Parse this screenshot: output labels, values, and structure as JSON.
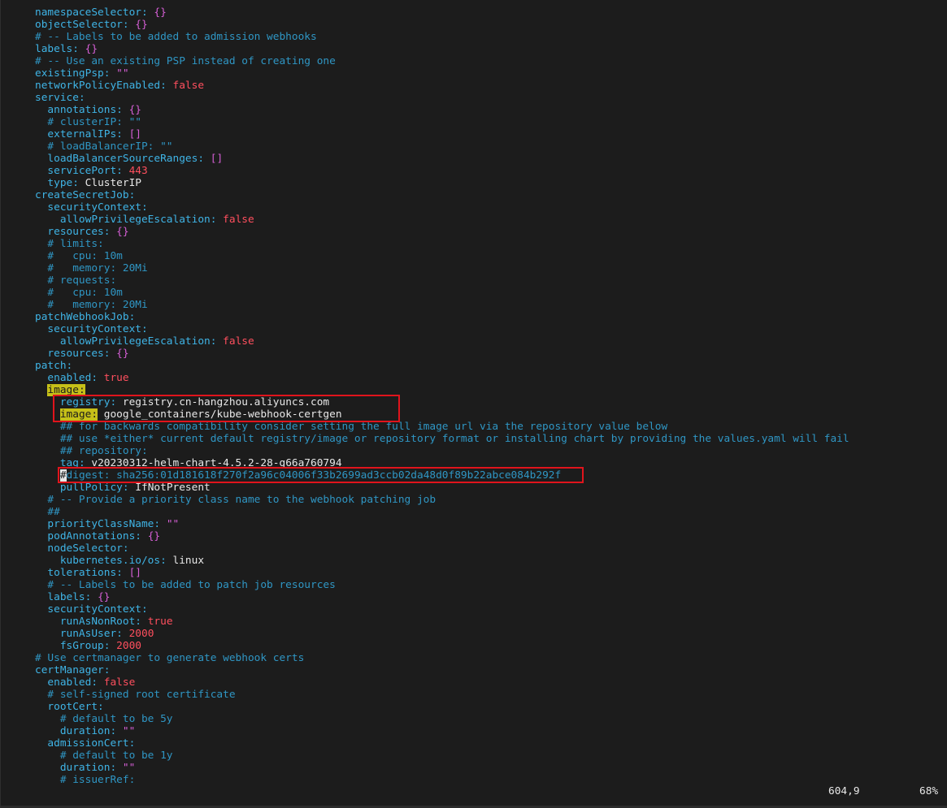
{
  "editor": {
    "lines": [
      [
        {
          "t": "namespaceSelector",
          "s": "k"
        },
        {
          "t": ": ",
          "s": "p"
        },
        {
          "t": "{}",
          "s": "b"
        }
      ],
      [
        {
          "t": "objectSelector",
          "s": "k"
        },
        {
          "t": ": ",
          "s": "p"
        },
        {
          "t": "{}",
          "s": "b"
        }
      ],
      [
        {
          "t": "# -- Labels to be added to admission webhooks",
          "s": "c"
        }
      ],
      [
        {
          "t": "labels",
          "s": "k"
        },
        {
          "t": ": ",
          "s": "p"
        },
        {
          "t": "{}",
          "s": "b"
        }
      ],
      [
        {
          "t": "# -- Use an existing PSP instead of creating one",
          "s": "c"
        }
      ],
      [
        {
          "t": "existingPsp",
          "s": "k"
        },
        {
          "t": ": ",
          "s": "p"
        },
        {
          "t": "\"\"",
          "s": "b"
        }
      ],
      [
        {
          "t": "networkPolicyEnabled",
          "s": "k"
        },
        {
          "t": ": ",
          "s": "p"
        },
        {
          "t": "false",
          "s": "n"
        }
      ],
      [
        {
          "t": "service",
          "s": "k"
        },
        {
          "t": ":",
          "s": "p"
        }
      ],
      [
        {
          "t": "  annotations",
          "s": "k"
        },
        {
          "t": ": ",
          "s": "p"
        },
        {
          "t": "{}",
          "s": "b"
        }
      ],
      [
        {
          "t": "  # clusterIP: \"\"",
          "s": "c"
        }
      ],
      [
        {
          "t": "  externalIPs",
          "s": "k"
        },
        {
          "t": ": ",
          "s": "p"
        },
        {
          "t": "[]",
          "s": "b"
        }
      ],
      [
        {
          "t": "  # loadBalancerIP: \"\"",
          "s": "c"
        }
      ],
      [
        {
          "t": "  loadBalancerSourceRanges",
          "s": "k"
        },
        {
          "t": ": ",
          "s": "p"
        },
        {
          "t": "[]",
          "s": "b"
        }
      ],
      [
        {
          "t": "  servicePort",
          "s": "k"
        },
        {
          "t": ": ",
          "s": "p"
        },
        {
          "t": "443",
          "s": "n"
        }
      ],
      [
        {
          "t": "  type",
          "s": "k"
        },
        {
          "t": ": ",
          "s": "p"
        },
        {
          "t": "ClusterIP",
          "s": "v"
        }
      ],
      [
        {
          "t": "createSecretJob",
          "s": "k"
        },
        {
          "t": ":",
          "s": "p"
        }
      ],
      [
        {
          "t": "  securityContext",
          "s": "k"
        },
        {
          "t": ":",
          "s": "p"
        }
      ],
      [
        {
          "t": "    allowPrivilegeEscalation",
          "s": "k"
        },
        {
          "t": ": ",
          "s": "p"
        },
        {
          "t": "false",
          "s": "n"
        }
      ],
      [
        {
          "t": "  resources",
          "s": "k"
        },
        {
          "t": ": ",
          "s": "p"
        },
        {
          "t": "{}",
          "s": "b"
        }
      ],
      [
        {
          "t": "  # limits:",
          "s": "c"
        }
      ],
      [
        {
          "t": "  #   cpu: 10m",
          "s": "c"
        }
      ],
      [
        {
          "t": "  #   memory: 20Mi",
          "s": "c"
        }
      ],
      [
        {
          "t": "  # requests:",
          "s": "c"
        }
      ],
      [
        {
          "t": "  #   cpu: 10m",
          "s": "c"
        }
      ],
      [
        {
          "t": "  #   memory: 20Mi",
          "s": "c"
        }
      ],
      [
        {
          "t": "patchWebhookJob",
          "s": "k"
        },
        {
          "t": ":",
          "s": "p"
        }
      ],
      [
        {
          "t": "  securityContext",
          "s": "k"
        },
        {
          "t": ":",
          "s": "p"
        }
      ],
      [
        {
          "t": "    allowPrivilegeEscalation",
          "s": "k"
        },
        {
          "t": ": ",
          "s": "p"
        },
        {
          "t": "false",
          "s": "n"
        }
      ],
      [
        {
          "t": "  resources",
          "s": "k"
        },
        {
          "t": ": ",
          "s": "p"
        },
        {
          "t": "{}",
          "s": "b"
        }
      ],
      [
        {
          "t": "patch",
          "s": "k"
        },
        {
          "t": ":",
          "s": "p"
        }
      ],
      [
        {
          "t": "  enabled",
          "s": "k"
        },
        {
          "t": ": ",
          "s": "p"
        },
        {
          "t": "true",
          "s": "n"
        }
      ],
      [
        {
          "t": "  ",
          "s": "v"
        },
        {
          "t": "image:",
          "s": "hl"
        }
      ],
      [
        {
          "t": "    registry",
          "s": "k"
        },
        {
          "t": ": ",
          "s": "p"
        },
        {
          "t": "registry.cn-hangzhou.aliyuncs.com",
          "s": "v"
        }
      ],
      [
        {
          "t": "    ",
          "s": "v"
        },
        {
          "t": "image:",
          "s": "hl"
        },
        {
          "t": " google_containers/kube-webhook-certgen",
          "s": "v"
        }
      ],
      [
        {
          "t": "    ## for backwards compatibility consider setting the full image url via the repository value below",
          "s": "c"
        }
      ],
      [
        {
          "t": "    ## use *either* current default registry/image or repository format or installing chart by providing the values.yaml will fail",
          "s": "c"
        }
      ],
      [
        {
          "t": "    ## repository:",
          "s": "c"
        }
      ],
      [
        {
          "t": "    tag",
          "s": "k"
        },
        {
          "t": ": ",
          "s": "p"
        },
        {
          "t": "v20230312-helm-chart-4.5.2-28-g66a760794",
          "s": "v"
        }
      ],
      [
        {
          "t": "    ",
          "s": "v"
        },
        {
          "t": "#",
          "s": "cur"
        },
        {
          "t": "digest: sha256:01d181618f270f2a96c04006f33b2699ad3ccb02da48d0f89b22abce084b292f",
          "s": "c"
        }
      ],
      [
        {
          "t": "    pullPolicy",
          "s": "k"
        },
        {
          "t": ": ",
          "s": "p"
        },
        {
          "t": "IfNotPresent",
          "s": "v"
        }
      ],
      [
        {
          "t": "  # -- Provide a priority class name to the webhook patching job",
          "s": "c"
        }
      ],
      [
        {
          "t": "  ##",
          "s": "c"
        }
      ],
      [
        {
          "t": "  priorityClassName",
          "s": "k"
        },
        {
          "t": ": ",
          "s": "p"
        },
        {
          "t": "\"\"",
          "s": "b"
        }
      ],
      [
        {
          "t": "  podAnnotations",
          "s": "k"
        },
        {
          "t": ": ",
          "s": "p"
        },
        {
          "t": "{}",
          "s": "b"
        }
      ],
      [
        {
          "t": "  nodeSelector",
          "s": "k"
        },
        {
          "t": ":",
          "s": "p"
        }
      ],
      [
        {
          "t": "    kubernetes.io/os",
          "s": "k"
        },
        {
          "t": ": ",
          "s": "p"
        },
        {
          "t": "linux",
          "s": "v"
        }
      ],
      [
        {
          "t": "  tolerations",
          "s": "k"
        },
        {
          "t": ": ",
          "s": "p"
        },
        {
          "t": "[]",
          "s": "b"
        }
      ],
      [
        {
          "t": "  # -- Labels to be added to patch job resources",
          "s": "c"
        }
      ],
      [
        {
          "t": "  labels",
          "s": "k"
        },
        {
          "t": ": ",
          "s": "p"
        },
        {
          "t": "{}",
          "s": "b"
        }
      ],
      [
        {
          "t": "  securityContext",
          "s": "k"
        },
        {
          "t": ":",
          "s": "p"
        }
      ],
      [
        {
          "t": "    runAsNonRoot",
          "s": "k"
        },
        {
          "t": ": ",
          "s": "p"
        },
        {
          "t": "true",
          "s": "n"
        }
      ],
      [
        {
          "t": "    runAsUser",
          "s": "k"
        },
        {
          "t": ": ",
          "s": "p"
        },
        {
          "t": "2000",
          "s": "n"
        }
      ],
      [
        {
          "t": "    fsGroup",
          "s": "k"
        },
        {
          "t": ": ",
          "s": "p"
        },
        {
          "t": "2000",
          "s": "n"
        }
      ],
      [
        {
          "t": "# Use certmanager to generate webhook certs",
          "s": "c"
        }
      ],
      [
        {
          "t": "certManager",
          "s": "k"
        },
        {
          "t": ":",
          "s": "p"
        }
      ],
      [
        {
          "t": "  enabled",
          "s": "k"
        },
        {
          "t": ": ",
          "s": "p"
        },
        {
          "t": "false",
          "s": "n"
        }
      ],
      [
        {
          "t": "  # self-signed root certificate",
          "s": "c"
        }
      ],
      [
        {
          "t": "  rootCert",
          "s": "k"
        },
        {
          "t": ":",
          "s": "p"
        }
      ],
      [
        {
          "t": "    # default to be 5y",
          "s": "c"
        }
      ],
      [
        {
          "t": "    duration",
          "s": "k"
        },
        {
          "t": ": ",
          "s": "p"
        },
        {
          "t": "\"\"",
          "s": "b"
        }
      ],
      [
        {
          "t": "  admissionCert",
          "s": "k"
        },
        {
          "t": ":",
          "s": "p"
        }
      ],
      [
        {
          "t": "    # default to be 1y",
          "s": "c"
        }
      ],
      [
        {
          "t": "    duration",
          "s": "k"
        },
        {
          "t": ": ",
          "s": "p"
        },
        {
          "t": "\"\"",
          "s": "b"
        }
      ],
      [
        {
          "t": "    # issuerRef:",
          "s": "c"
        }
      ]
    ]
  },
  "status": {
    "cursor_position": "604,9",
    "scroll_percent": "68%"
  },
  "colors": {
    "background": "#1c1c1c",
    "key": "#3fb4e6",
    "comment": "#2f96c4",
    "bracket": "#d65fd6",
    "literal": "#ff4f5e",
    "value": "#e8e8e8",
    "search_highlight": "#c6c018",
    "annotation_box": "#e0141c"
  }
}
